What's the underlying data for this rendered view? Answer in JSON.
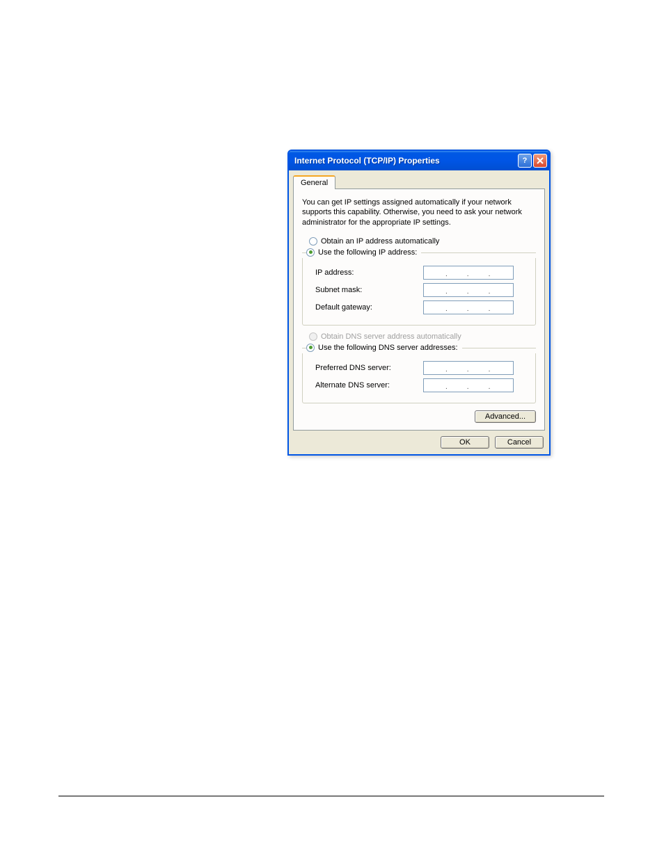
{
  "dialog": {
    "title": "Internet Protocol (TCP/IP) Properties",
    "tabs": [
      {
        "label": "General"
      }
    ],
    "description": "You can get IP settings assigned automatically if your network supports this capability. Otherwise, you need to ask your network administrator for the appropriate IP settings.",
    "ip_group": {
      "auto_label": "Obtain an IP address automatically",
      "manual_label": "Use the following IP address:",
      "auto_selected": false,
      "manual_selected": true,
      "fields": {
        "ip_label": "IP address:",
        "subnet_label": "Subnet mask:",
        "gateway_label": "Default gateway:",
        "ip_value": [
          "",
          "",
          "",
          ""
        ],
        "subnet_value": [
          "",
          "",
          "",
          ""
        ],
        "gateway_value": [
          "",
          "",
          "",
          ""
        ]
      }
    },
    "dns_group": {
      "auto_label": "Obtain DNS server address automatically",
      "manual_label": "Use the following DNS server addresses:",
      "auto_disabled": true,
      "manual_selected": true,
      "fields": {
        "preferred_label": "Preferred DNS server:",
        "alternate_label": "Alternate DNS server:",
        "preferred_value": [
          "",
          "",
          "",
          ""
        ],
        "alternate_value": [
          "",
          "",
          "",
          ""
        ]
      }
    },
    "buttons": {
      "advanced": "Advanced...",
      "ok": "OK",
      "cancel": "Cancel"
    }
  }
}
